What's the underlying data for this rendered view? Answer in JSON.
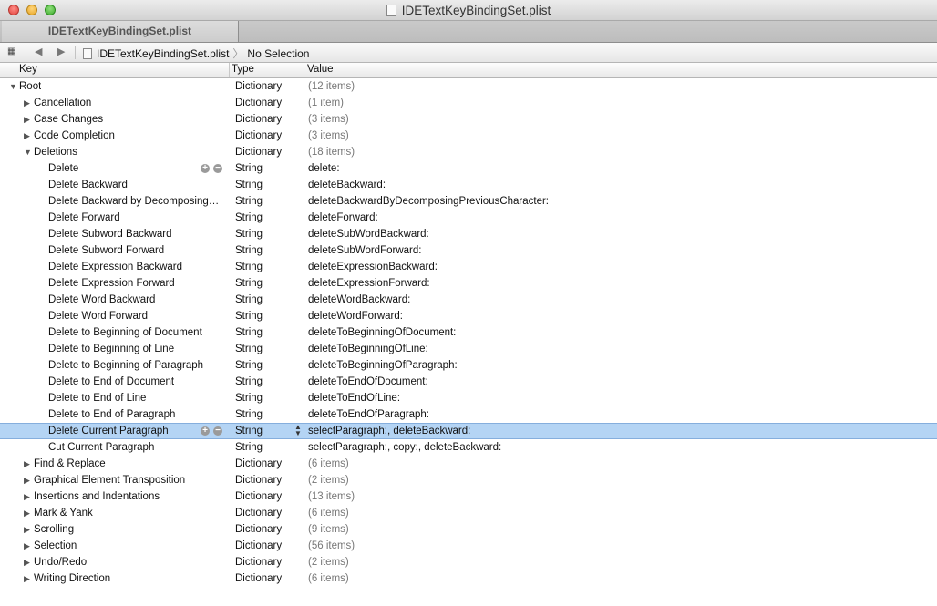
{
  "window": {
    "title": "IDETextKeyBindingSet.plist"
  },
  "tab": {
    "label": "IDETextKeyBindingSet.plist"
  },
  "jumpbar": {
    "file": "IDETextKeyBindingSet.plist",
    "selection": "No Selection"
  },
  "columns": {
    "key": "Key",
    "type": "Type",
    "value": "Value"
  },
  "rows": [
    {
      "key": "Root",
      "type": "Dictionary",
      "value": "(12 items)",
      "level": 0,
      "expandable": true,
      "expanded": true,
      "muted": true
    },
    {
      "key": "Cancellation",
      "type": "Dictionary",
      "value": "(1 item)",
      "level": 1,
      "expandable": true,
      "expanded": false,
      "muted": true
    },
    {
      "key": "Case Changes",
      "type": "Dictionary",
      "value": "(3 items)",
      "level": 1,
      "expandable": true,
      "expanded": false,
      "muted": true
    },
    {
      "key": "Code Completion",
      "type": "Dictionary",
      "value": "(3 items)",
      "level": 1,
      "expandable": true,
      "expanded": false,
      "muted": true
    },
    {
      "key": "Deletions",
      "type": "Dictionary",
      "value": "(18 items)",
      "level": 1,
      "expandable": true,
      "expanded": true,
      "muted": true
    },
    {
      "key": "Delete",
      "type": "String",
      "value": "delete:",
      "level": 2,
      "hover": true
    },
    {
      "key": "Delete Backward",
      "type": "String",
      "value": "deleteBackward:",
      "level": 2
    },
    {
      "key": "Delete Backward by Decomposing…",
      "type": "String",
      "value": "deleteBackwardByDecomposingPreviousCharacter:",
      "level": 2
    },
    {
      "key": "Delete Forward",
      "type": "String",
      "value": "deleteForward:",
      "level": 2
    },
    {
      "key": "Delete Subword Backward",
      "type": "String",
      "value": "deleteSubWordBackward:",
      "level": 2
    },
    {
      "key": "Delete Subword Forward",
      "type": "String",
      "value": "deleteSubWordForward:",
      "level": 2
    },
    {
      "key": "Delete Expression Backward",
      "type": "String",
      "value": "deleteExpressionBackward:",
      "level": 2
    },
    {
      "key": "Delete Expression Forward",
      "type": "String",
      "value": "deleteExpressionForward:",
      "level": 2
    },
    {
      "key": "Delete Word Backward",
      "type": "String",
      "value": "deleteWordBackward:",
      "level": 2
    },
    {
      "key": "Delete Word Forward",
      "type": "String",
      "value": "deleteWordForward:",
      "level": 2
    },
    {
      "key": "Delete to Beginning of Document",
      "type": "String",
      "value": "deleteToBeginningOfDocument:",
      "level": 2
    },
    {
      "key": "Delete to Beginning of Line",
      "type": "String",
      "value": "deleteToBeginningOfLine:",
      "level": 2
    },
    {
      "key": "Delete to Beginning of Paragraph",
      "type": "String",
      "value": "deleteToBeginningOfParagraph:",
      "level": 2
    },
    {
      "key": "Delete to End of Document",
      "type": "String",
      "value": "deleteToEndOfDocument:",
      "level": 2
    },
    {
      "key": "Delete to End of Line",
      "type": "String",
      "value": "deleteToEndOfLine:",
      "level": 2
    },
    {
      "key": "Delete to End of Paragraph",
      "type": "String",
      "value": "deleteToEndOfParagraph:",
      "level": 2
    },
    {
      "key": "Delete Current Paragraph",
      "type": "String",
      "value": "selectParagraph:, deleteBackward:",
      "level": 2,
      "selected": true
    },
    {
      "key": "Cut Current Paragraph",
      "type": "String",
      "value": "selectParagraph:, copy:, deleteBackward:",
      "level": 2
    },
    {
      "key": "Find & Replace",
      "type": "Dictionary",
      "value": "(6 items)",
      "level": 1,
      "expandable": true,
      "expanded": false,
      "muted": true
    },
    {
      "key": "Graphical Element Transposition",
      "type": "Dictionary",
      "value": "(2 items)",
      "level": 1,
      "expandable": true,
      "expanded": false,
      "muted": true
    },
    {
      "key": "Insertions and Indentations",
      "type": "Dictionary",
      "value": "(13 items)",
      "level": 1,
      "expandable": true,
      "expanded": false,
      "muted": true
    },
    {
      "key": "Mark & Yank",
      "type": "Dictionary",
      "value": "(6 items)",
      "level": 1,
      "expandable": true,
      "expanded": false,
      "muted": true
    },
    {
      "key": "Scrolling",
      "type": "Dictionary",
      "value": "(9 items)",
      "level": 1,
      "expandable": true,
      "expanded": false,
      "muted": true
    },
    {
      "key": "Selection",
      "type": "Dictionary",
      "value": "(56 items)",
      "level": 1,
      "expandable": true,
      "expanded": false,
      "muted": true
    },
    {
      "key": "Undo/Redo",
      "type": "Dictionary",
      "value": "(2 items)",
      "level": 1,
      "expandable": true,
      "expanded": false,
      "muted": true
    },
    {
      "key": "Writing Direction",
      "type": "Dictionary",
      "value": "(6 items)",
      "level": 1,
      "expandable": true,
      "expanded": false,
      "muted": true
    }
  ]
}
